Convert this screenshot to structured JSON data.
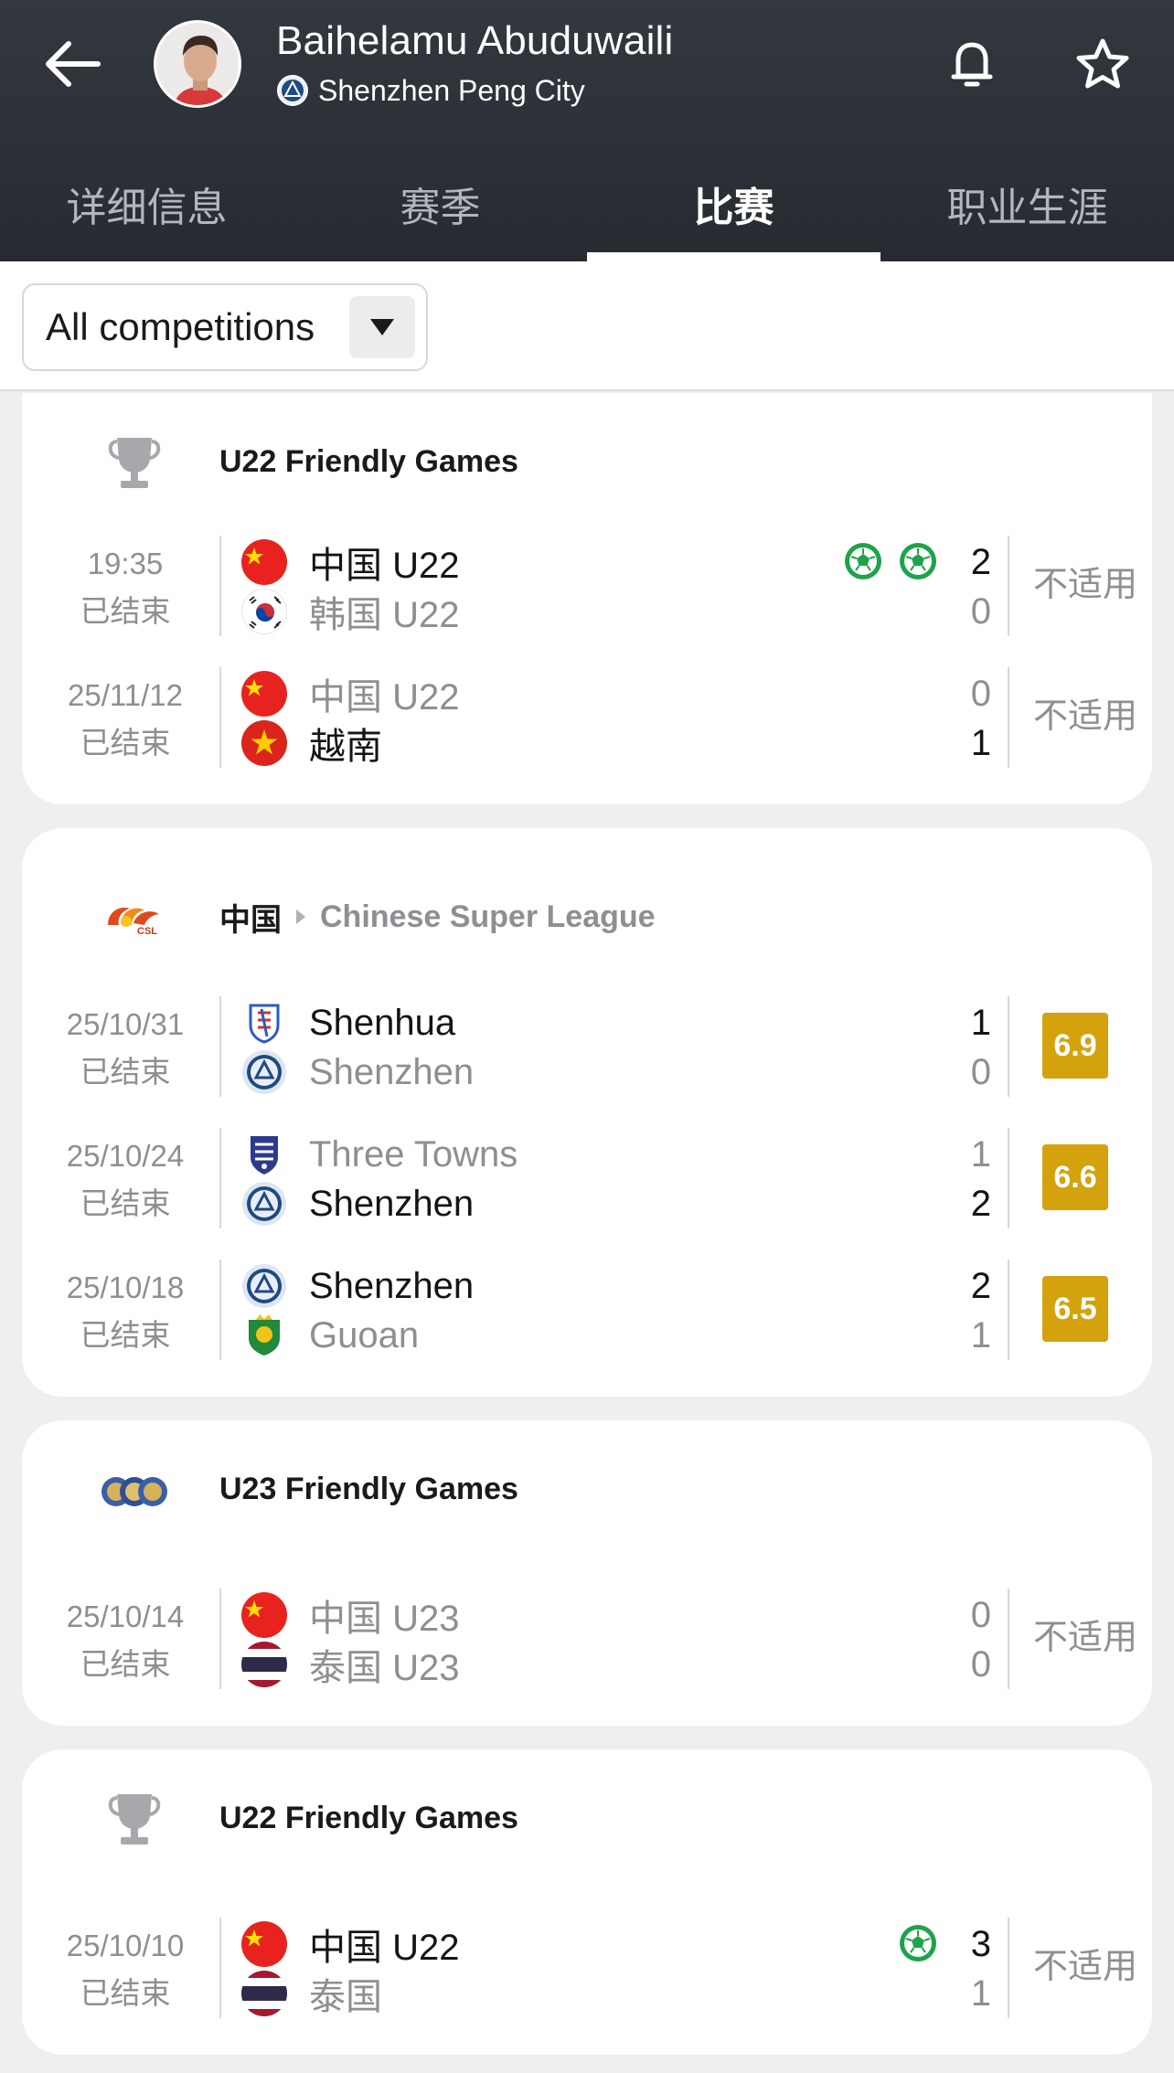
{
  "header": {
    "player_name": "Baihelamu Abuduwaili",
    "team_name": "Shenzhen Peng City",
    "back_icon": "arrow-left-icon",
    "bell_icon": "bell-icon",
    "star_icon": "star-icon"
  },
  "tabs": [
    {
      "label": "详细信息",
      "active": false
    },
    {
      "label": "赛季",
      "active": false
    },
    {
      "label": "比赛",
      "active": true
    },
    {
      "label": "职业生涯",
      "active": false
    }
  ],
  "filter": {
    "selected": "All competitions",
    "arrow_icon": "triangle-down-icon"
  },
  "colors": {
    "header_bg": "#2c3037",
    "rating_bg": "#d4a20c",
    "goal_green": "#1fa34a",
    "muted_text": "#8e8e93"
  },
  "competitions": [
    {
      "title": "U22 Friendly Games",
      "icon": "trophy-icon",
      "matches": [
        {
          "date": "19:35",
          "status": "已结束",
          "home": {
            "name": "中国 U22",
            "flag": "china-flag-icon",
            "score": "2",
            "winner": true
          },
          "away": {
            "name": "韩国 U22",
            "flag": "korea-flag-icon",
            "score": "0",
            "winner": false
          },
          "goals": 2,
          "rating": "不适用"
        },
        {
          "date": "25/11/12",
          "status": "已结束",
          "home": {
            "name": "中国 U22",
            "flag": "china-flag-icon",
            "score": "0",
            "winner": false
          },
          "away": {
            "name": "越南",
            "flag": "vietnam-flag-icon",
            "score": "1",
            "winner": true
          },
          "goals": 0,
          "rating": "不适用"
        }
      ]
    },
    {
      "title": "中国",
      "subtitle": "Chinese Super League",
      "icon": "csl-logo-icon",
      "matches": [
        {
          "date": "25/10/31",
          "status": "已结束",
          "home": {
            "name": "Shenhua",
            "flag": "shenhua-crest-icon",
            "score": "1",
            "winner": true
          },
          "away": {
            "name": "Shenzhen",
            "flag": "shenzhen-crest-icon",
            "score": "0",
            "winner": false
          },
          "goals": 0,
          "rating": "6.9"
        },
        {
          "date": "25/10/24",
          "status": "已结束",
          "home": {
            "name": "Three Towns",
            "flag": "three-towns-crest-icon",
            "score": "1",
            "winner": false
          },
          "away": {
            "name": "Shenzhen",
            "flag": "shenzhen-crest-icon",
            "score": "2",
            "winner": true
          },
          "goals": 0,
          "rating": "6.6"
        },
        {
          "date": "25/10/18",
          "status": "已结束",
          "home": {
            "name": "Shenzhen",
            "flag": "shenzhen-crest-icon",
            "score": "2",
            "winner": true
          },
          "away": {
            "name": "Guoan",
            "flag": "guoan-crest-icon",
            "score": "1",
            "winner": false
          },
          "goals": 0,
          "rating": "6.5"
        }
      ]
    },
    {
      "title": "U23 Friendly Games",
      "icon": "balls-icon",
      "matches": [
        {
          "date": "25/10/14",
          "status": "已结束",
          "home": {
            "name": "中国 U23",
            "flag": "china-flag-icon",
            "score": "0",
            "winner": false
          },
          "away": {
            "name": "泰国 U23",
            "flag": "thailand-flag-icon",
            "score": "0",
            "winner": false
          },
          "goals": 0,
          "rating": "不适用"
        }
      ]
    },
    {
      "title": "U22 Friendly Games",
      "icon": "trophy-icon",
      "matches": [
        {
          "date": "25/10/10",
          "status": "已结束",
          "home": {
            "name": "中国 U22",
            "flag": "china-flag-icon",
            "score": "3",
            "winner": true
          },
          "away": {
            "name": "泰国",
            "flag": "thailand-flag-icon",
            "score": "1",
            "winner": false
          },
          "goals": 1,
          "rating": "不适用"
        }
      ]
    }
  ]
}
